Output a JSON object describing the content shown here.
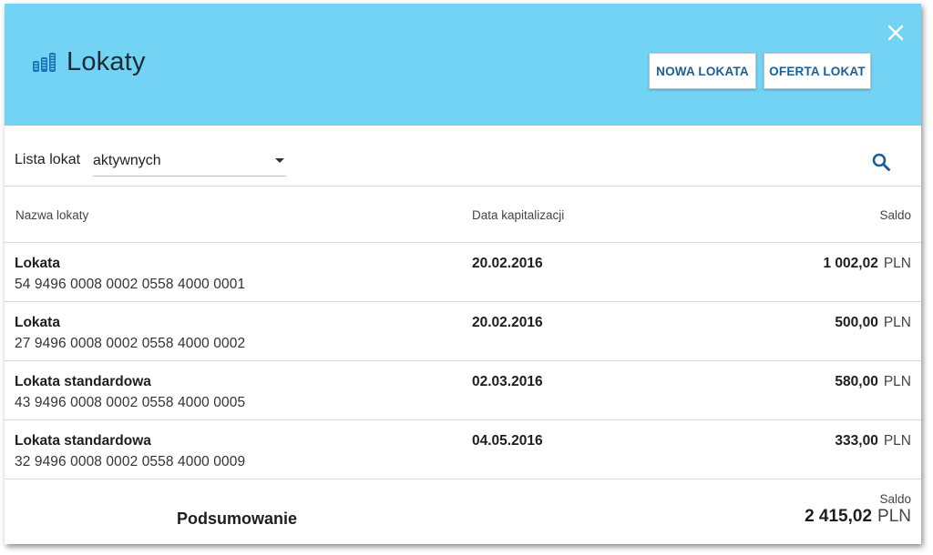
{
  "header": {
    "title": "Lokaty",
    "new_button": "NOWA LOKATA",
    "offer_button": "OFERTA LOKAT"
  },
  "filter": {
    "label": "Lista lokat",
    "selected": "aktywnych"
  },
  "table": {
    "columns": {
      "name": "Nazwa lokaty",
      "date": "Data kapitalizacji",
      "saldo": "Saldo"
    },
    "rows": [
      {
        "name": "Lokata",
        "account": "54 9496 0008 0002 0558 4000 0001",
        "date": "20.02.2016",
        "amount": "1 002,02",
        "currency": "PLN"
      },
      {
        "name": "Lokata",
        "account": "27 9496 0008 0002 0558 4000 0002",
        "date": "20.02.2016",
        "amount": "500,00",
        "currency": "PLN"
      },
      {
        "name": "Lokata standardowa",
        "account": "43 9496 0008 0002 0558 4000 0005",
        "date": "02.03.2016",
        "amount": "580,00",
        "currency": "PLN"
      },
      {
        "name": "Lokata standardowa",
        "account": "32 9496 0008 0002 0558 4000 0009",
        "date": "04.05.2016",
        "amount": "333,00",
        "currency": "PLN"
      }
    ]
  },
  "summary": {
    "label": "Podsumowanie",
    "saldo_label": "Saldo",
    "amount": "2 415,02",
    "currency": "PLN"
  },
  "icons": {
    "title": "coins-stack-icon",
    "close": "close-icon",
    "search": "search-icon",
    "dropdown": "chevron-down-icon"
  },
  "colors": {
    "header_bg": "#72d3f4",
    "button_text": "#1a5f98",
    "icon_blue": "#1a5f98"
  }
}
